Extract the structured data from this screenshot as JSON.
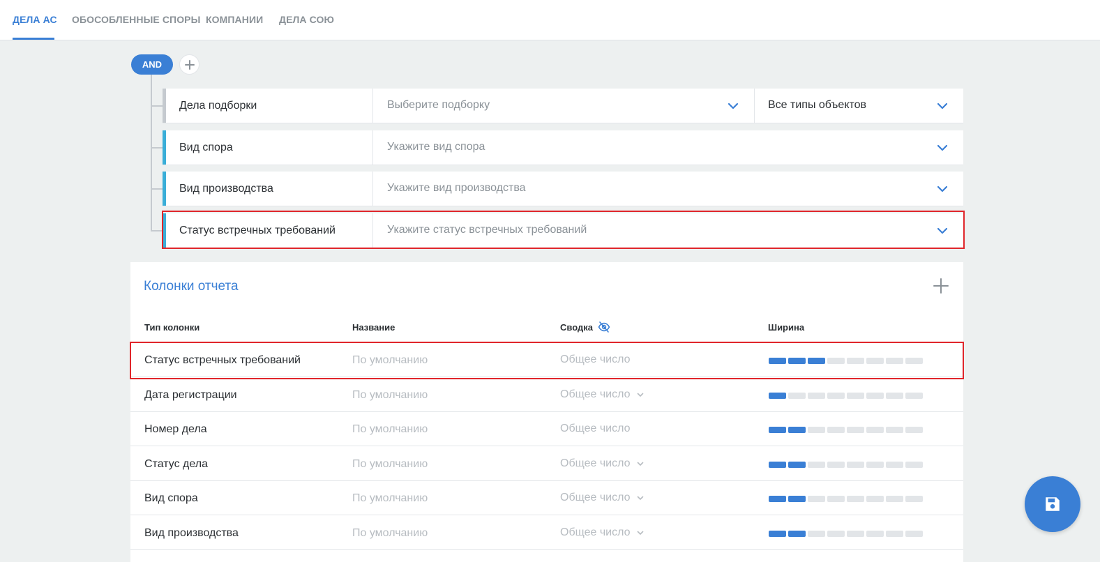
{
  "tabs": [
    {
      "label": "ДЕЛА АС",
      "active": true
    },
    {
      "label": "ОБОСОБЛЕННЫЕ СПОРЫ",
      "active": false
    },
    {
      "label": "КОМПАНИИ",
      "active": false
    },
    {
      "label": "ДЕЛА СОЮ",
      "active": false
    }
  ],
  "filter": {
    "operator_label": "AND",
    "rows": [
      {
        "label": "Дела подборки",
        "placeholder": "Выберите подборку",
        "extra_value": "Все типы объектов",
        "bar_color": "#c5cacf"
      },
      {
        "label": "Вид спора",
        "placeholder": "Укажите вид спора",
        "bar_color": "#3aaed8"
      },
      {
        "label": "Вид производства",
        "placeholder": "Укажите вид производства",
        "bar_color": "#3aaed8"
      },
      {
        "label": "Статус встречных требований",
        "placeholder": "Укажите статус встречных требований",
        "bar_color": "#3aaed8",
        "highlighted": true
      }
    ]
  },
  "report": {
    "title": "Колонки отчета",
    "headers": {
      "type": "Тип колонки",
      "name": "Название",
      "summary": "Сводка",
      "width": "Ширина"
    },
    "rows": [
      {
        "type": "Статус встречных требований",
        "name": "По умолчанию",
        "summary": "Общее число",
        "has_dropdown": false,
        "width_level": 3,
        "highlighted": true
      },
      {
        "type": "Дата регистрации",
        "name": "По умолчанию",
        "summary": "Общее число",
        "has_dropdown": true,
        "width_level": 1
      },
      {
        "type": "Номер дела",
        "name": "По умолчанию",
        "summary": "Общее число",
        "has_dropdown": false,
        "width_level": 2
      },
      {
        "type": "Статус дела",
        "name": "По умолчанию",
        "summary": "Общее число",
        "has_dropdown": true,
        "width_level": 2
      },
      {
        "type": "Вид спора",
        "name": "По умолчанию",
        "summary": "Общее число",
        "has_dropdown": true,
        "width_level": 2
      },
      {
        "type": "Вид производства",
        "name": "По умолчанию",
        "summary": "Общее число",
        "has_dropdown": true,
        "width_level": 2
      }
    ],
    "width_segments_total": 8
  },
  "icons": {
    "add": "plus-icon",
    "summary_hidden": "eye-off-icon",
    "save": "floppy-disk-icon",
    "dropdown": "chevron-down-icon"
  },
  "colors": {
    "accent": "#3a7fd5",
    "highlight": "#e0262b"
  }
}
